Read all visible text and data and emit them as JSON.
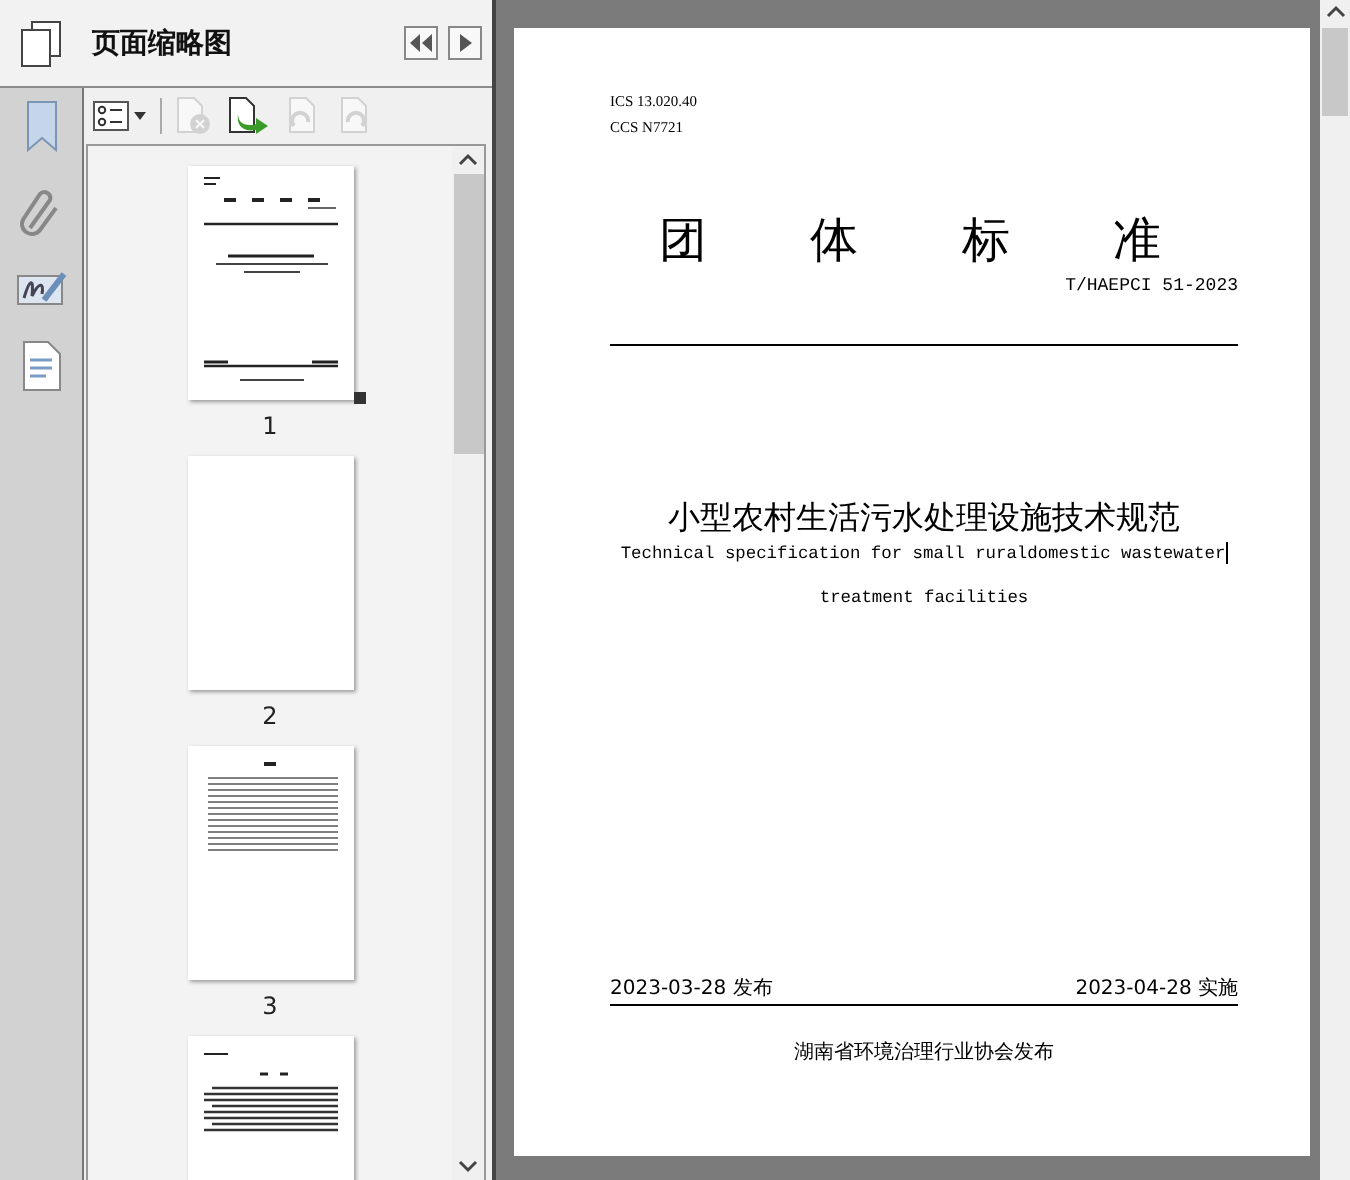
{
  "panel": {
    "title": "页面缩略图"
  },
  "toolbar": [
    {
      "kind": "options",
      "disabled": false
    },
    {
      "kind": "delete",
      "disabled": true
    },
    {
      "kind": "insert",
      "disabled": false
    },
    {
      "kind": "rotate-left",
      "disabled": true
    },
    {
      "kind": "rotate-right",
      "disabled": true
    }
  ],
  "thumbnails": [
    {
      "kind": "cover",
      "label": "1",
      "selected": true
    },
    {
      "kind": "blank",
      "label": "2",
      "selected": false
    },
    {
      "kind": "contents",
      "label": "3",
      "selected": false
    },
    {
      "kind": "text",
      "selected": false
    }
  ],
  "document": {
    "ics": "ICS 13.020.40",
    "ccs": "CCS N7721",
    "heading": "团 体 标 准",
    "number": "T/HAEPCI 51-2023",
    "title_zh": "小型农村生活污水处理设施技术规范",
    "title_en": [
      "Technical specification for small ruraldomestic wastewater",
      "treatment facilities"
    ],
    "issued": "2023-03-28 发布",
    "effective": "2023-04-28 实施",
    "publisher": "湖南省环境治理行业协会发布"
  }
}
